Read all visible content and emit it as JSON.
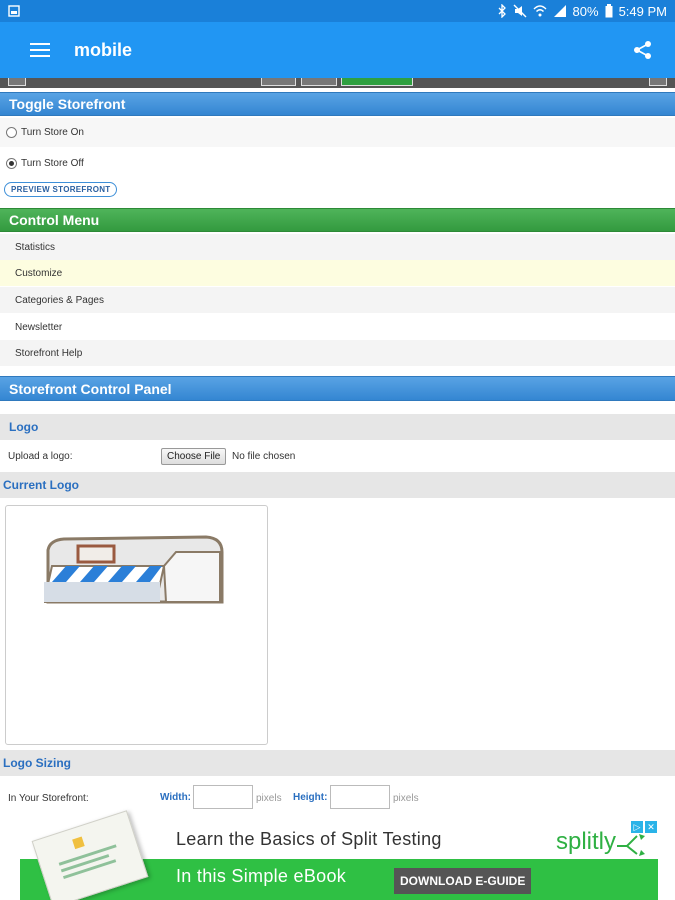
{
  "status_bar": {
    "battery": "80%",
    "time": "5:49 PM"
  },
  "app_bar": {
    "title": "mobile"
  },
  "toggle_storefront": {
    "header": "Toggle Storefront",
    "option_on": "Turn Store On",
    "option_off": "Turn Store Off",
    "selected": "off",
    "preview_button": "PREVIEW STOREFRONT"
  },
  "control_menu": {
    "header": "Control Menu",
    "items": [
      {
        "label": "Statistics",
        "highlighted": false
      },
      {
        "label": "Customize",
        "highlighted": true
      },
      {
        "label": "Categories & Pages",
        "highlighted": false
      },
      {
        "label": "Newsletter",
        "highlighted": false
      },
      {
        "label": "Storefront Help",
        "highlighted": false
      }
    ]
  },
  "control_panel": {
    "header": "Storefront Control Panel",
    "logo_header": "Logo",
    "upload_label": "Upload a logo:",
    "choose_file": "Choose File",
    "no_file": "No file chosen",
    "current_logo": "Current Logo",
    "logo_sizing": "Logo Sizing",
    "in_storefront": "In Your Storefront:",
    "width_label": "Width:",
    "height_label": "Height:",
    "pixels": "pixels"
  },
  "ad": {
    "headline": "Learn the Basics of Split Testing",
    "subline": "In this Simple eBook",
    "cta": "DOWNLOAD E-GUIDE",
    "brand": "splitly"
  },
  "colors": {
    "status_bar": "#1a80d9",
    "app_bar": "#2196f3",
    "blue_header": "#3d8fd8",
    "green_header": "#3ea34a",
    "link_blue": "#2a6fc0",
    "highlight_row": "#fdfde0"
  }
}
